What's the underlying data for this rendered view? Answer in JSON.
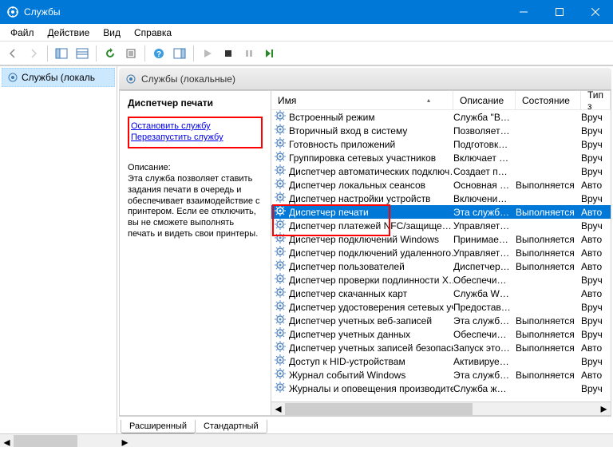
{
  "window": {
    "title": "Службы"
  },
  "menu": {
    "file": "Файл",
    "action": "Действие",
    "view": "Вид",
    "help": "Справка"
  },
  "tree": {
    "root": "Службы (локаль"
  },
  "pane": {
    "title": "Службы (локальные)"
  },
  "detail": {
    "heading": "Диспетчер печати",
    "stop": "Остановить",
    "restart": "Перезапустить",
    "suffix": " службу",
    "desc_label": "Описание:",
    "desc_text": "Эта служба позволяет ставить задания печати в очередь и обеспечивает взаимодействие с принтером. Если ее отключить, вы не сможете выполнять печать и видеть свои принтеры."
  },
  "columns": {
    "name": "Имя",
    "desc": "Описание",
    "state": "Состояние",
    "type": "Тип з"
  },
  "services": [
    {
      "name": "Встроенный режим",
      "desc": "Служба \"В…",
      "state": "",
      "type": "Вруч"
    },
    {
      "name": "Вторичный вход в систему",
      "desc": "Позволяет…",
      "state": "",
      "type": "Вруч"
    },
    {
      "name": "Готовность приложений",
      "desc": "Подготовк…",
      "state": "",
      "type": "Вруч"
    },
    {
      "name": "Группировка сетевых участников",
      "desc": "Включает …",
      "state": "",
      "type": "Вруч"
    },
    {
      "name": "Диспетчер автоматических подключ…",
      "desc": "Создает п…",
      "state": "",
      "type": "Вруч"
    },
    {
      "name": "Диспетчер локальных сеансов",
      "desc": "Основная …",
      "state": "Выполняется",
      "type": "Авто"
    },
    {
      "name": "Диспетчер настройки устройств",
      "desc": "Включени…",
      "state": "",
      "type": "Вруч"
    },
    {
      "name": "Диспетчер печати",
      "desc": "Эта служб…",
      "state": "Выполняется",
      "type": "Авто",
      "selected": true
    },
    {
      "name": "Диспетчер платежей NFC/защище…",
      "desc": "Управляет…",
      "state": "",
      "type": "Вруч"
    },
    {
      "name": "Диспетчер подключений Windows",
      "desc": "Принимае…",
      "state": "Выполняется",
      "type": "Авто"
    },
    {
      "name": "Диспетчер подключений удаленного…",
      "desc": "Управляет…",
      "state": "Выполняется",
      "type": "Авто"
    },
    {
      "name": "Диспетчер пользователей",
      "desc": "Диспетчер…",
      "state": "Выполняется",
      "type": "Авто"
    },
    {
      "name": "Диспетчер проверки подлинности X…",
      "desc": "Обеспечи…",
      "state": "",
      "type": "Вруч"
    },
    {
      "name": "Диспетчер скачанных карт",
      "desc": "Служба W…",
      "state": "",
      "type": "Авто"
    },
    {
      "name": "Диспетчер удостоверения сетевых уч…",
      "desc": "Предостав…",
      "state": "",
      "type": "Вруч"
    },
    {
      "name": "Диспетчер учетных веб-записей",
      "desc": "Эта служб…",
      "state": "Выполняется",
      "type": "Вруч"
    },
    {
      "name": "Диспетчер учетных данных",
      "desc": "Обеспечи…",
      "state": "Выполняется",
      "type": "Вруч"
    },
    {
      "name": "Диспетчер учетных записей безопасн…",
      "desc": "Запуск это…",
      "state": "Выполняется",
      "type": "Авто"
    },
    {
      "name": "Доступ к HID-устройствам",
      "desc": "Активируе…",
      "state": "",
      "type": "Вруч"
    },
    {
      "name": "Журнал событий Windows",
      "desc": "Эта служб…",
      "state": "Выполняется",
      "type": "Авто"
    },
    {
      "name": "Журналы и оповещения производите…",
      "desc": "Служба ж…",
      "state": "",
      "type": "Вруч"
    }
  ],
  "tabs": {
    "extended": "Расширенный",
    "standard": "Стандартный"
  }
}
